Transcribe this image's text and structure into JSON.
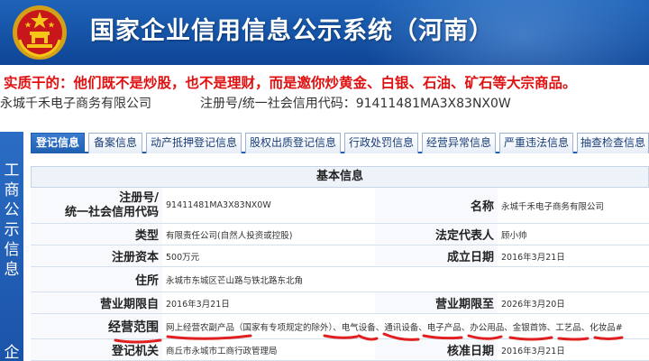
{
  "header": {
    "title": "国家企业信用信息公示系统（河南）",
    "brand_color": "#1553a6"
  },
  "notice": "实质干的：他们既不是炒股，也不是理财，而是邀你炒黄金、白银、石油、矿石等大宗商品。",
  "company": {
    "name": "永城千禾电子商务有限公司",
    "reg_label": "注册号/统一社会信用代码：",
    "reg_value": "91411481MA3X83NX0W"
  },
  "side_label": {
    "text": "工商公示信息",
    "next": "企"
  },
  "tabs": [
    {
      "label": "登记信息",
      "active": true
    },
    {
      "label": "备案信息",
      "active": false
    },
    {
      "label": "动产抵押登记信息",
      "active": false
    },
    {
      "label": "股权出质登记信息",
      "active": false
    },
    {
      "label": "行政处罚信息",
      "active": false
    },
    {
      "label": "经营异常信息",
      "active": false
    },
    {
      "label": "严重违法信息",
      "active": false
    },
    {
      "label": "抽查检查信息",
      "active": false
    }
  ],
  "basic_info": {
    "title": "基本信息",
    "reg_label_1": "注册号/",
    "reg_label_2": "统一社会信用代码",
    "reg_value": "91411481MA3X83NX0W",
    "name_label": "名称",
    "name_value": "永城千禾电子商务有限公司",
    "type_label": "类型",
    "type_value": "有限责任公司(自然人投资或控股)",
    "rep_label": "法定代表人",
    "rep_value": "顾小帅",
    "capital_label": "注册资本",
    "capital_value": "500万元",
    "founded_label": "成立日期",
    "founded_value": "2016年3月21日",
    "address_label": "住所",
    "address_value": "永城市东城区芒山路与铁北路东北角",
    "term_from_label": "营业期限自",
    "term_from_value": "2016年3月21日",
    "term_to_label": "营业期限至",
    "term_to_value": "2026年3月20日",
    "scope_label": "经营范围",
    "scope_value": "网上经营农副产品（国家有专项规定的除外）、电气设备、通讯设备、电子产品、办公用品、金银首饰、工艺品、化妆品#",
    "authority_label": "登记机关",
    "authority_value": "商丘市永城市工商行政管理局",
    "approval_label": "核准日期",
    "approval_value": "2016年3月21日"
  },
  "annotation_color": "#e02020"
}
